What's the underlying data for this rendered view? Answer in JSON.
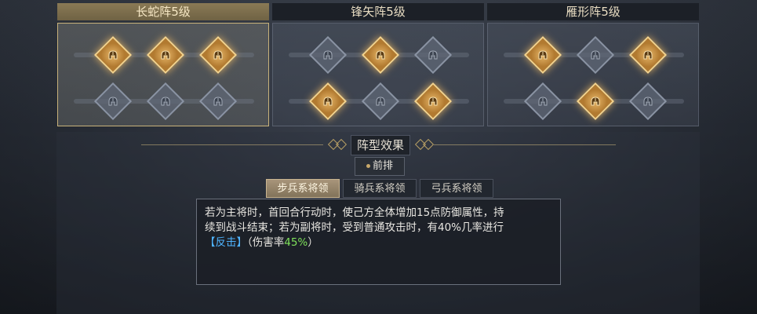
{
  "formations": [
    {
      "name": "长蛇阵5级",
      "selected": true,
      "rows": [
        [
          "on",
          "on",
          "on"
        ],
        [
          "off",
          "off",
          "off"
        ]
      ]
    },
    {
      "name": "锋矢阵5级",
      "selected": false,
      "rows": [
        [
          "off",
          "on",
          "off"
        ],
        [
          "on",
          "off",
          "on"
        ]
      ]
    },
    {
      "name": "雁形阵5级",
      "selected": false,
      "rows": [
        [
          "on",
          "off",
          "on"
        ],
        [
          "off",
          "on",
          "off"
        ]
      ]
    }
  ],
  "effect": {
    "title": "阵型效果",
    "position": "前排",
    "tabs": [
      "步兵系将领",
      "骑兵系将领",
      "弓兵系将领"
    ],
    "active_tab": 0,
    "desc_line1": "若为主将时，首回合行动时，使己方全体增加15点防御属性，持",
    "desc_line2": "续到战斗结束；若为副将时，受到普通攻击时，有40%几率进行",
    "desc_bracket": "【反击】",
    "desc_rest": "（伤害率",
    "desc_rate": "45%",
    "desc_end": "）"
  },
  "colors": {
    "gold": "#e8b86a",
    "highlight_blue": "#4fb4ff",
    "highlight_green": "#7ee05a"
  }
}
